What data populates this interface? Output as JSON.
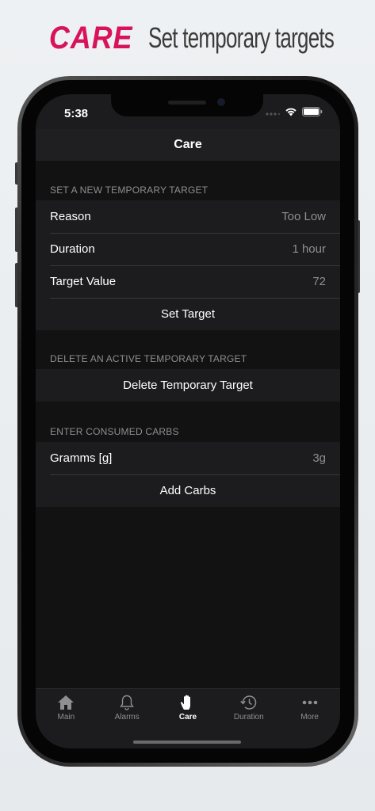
{
  "promo": {
    "brand": "CARE",
    "title": "Set temporary targets"
  },
  "status": {
    "time": "5:38"
  },
  "nav": {
    "title": "Care"
  },
  "sections": {
    "temp_target": {
      "header": "SET A NEW TEMPORARY TARGET",
      "rows": [
        {
          "label": "Reason",
          "value": "Too Low"
        },
        {
          "label": "Duration",
          "value": "1 hour"
        },
        {
          "label": "Target Value",
          "value": "72"
        }
      ],
      "action": "Set Target"
    },
    "delete_target": {
      "header": "DELETE AN ACTIVE TEMPORARY TARGET",
      "action": "Delete Temporary Target"
    },
    "carbs": {
      "header": "ENTER CONSUMED CARBS",
      "rows": [
        {
          "label": "Gramms [g]",
          "value": "3g"
        }
      ],
      "action": "Add Carbs"
    }
  },
  "tabs": [
    {
      "label": "Main",
      "icon": "house-icon"
    },
    {
      "label": "Alarms",
      "icon": "bell-icon"
    },
    {
      "label": "Care",
      "icon": "hand-icon",
      "active": true
    },
    {
      "label": "Duration",
      "icon": "clock-history-icon"
    },
    {
      "label": "More",
      "icon": "ellipsis-icon"
    }
  ],
  "colors": {
    "brand": "#d8135a",
    "background": "#121212",
    "cell": "#1c1c1e",
    "secondary_text": "#8e8e93"
  }
}
